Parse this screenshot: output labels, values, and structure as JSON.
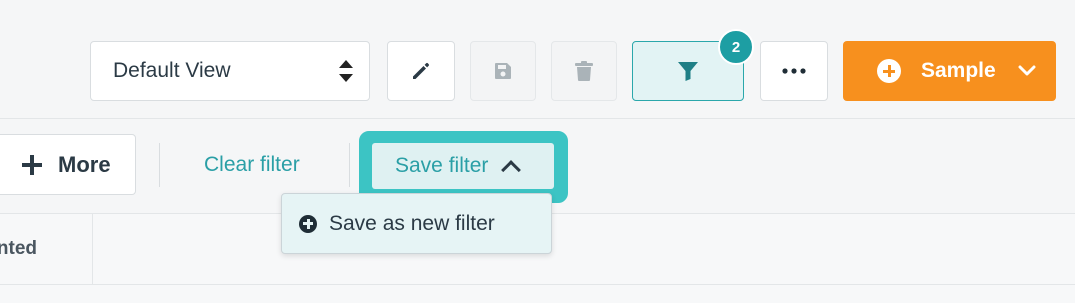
{
  "toolbar": {
    "view_select": {
      "value": "Default View"
    },
    "edit_icon": "pencil-icon",
    "save_view_icon": "floppy-disk-icon",
    "delete_icon": "trash-icon",
    "filter_icon": "funnel-icon",
    "filter_count": "2",
    "more_icon": "ellipsis-icon",
    "sample_button": {
      "label": "Sample",
      "icon": "plus-circle-icon",
      "dropdown_icon": "chevron-down-icon"
    }
  },
  "filter_bar": {
    "add_more_label": "More",
    "clear_filter_label": "Clear filter",
    "save_filter_label": "Save filter"
  },
  "save_filter_menu": {
    "items": [
      {
        "label": "Save as new filter",
        "icon": "plus-circle-icon"
      }
    ]
  },
  "table": {
    "column_header_partial": "nted"
  },
  "colors": {
    "accent": "#2a9fa6",
    "highlight": "#3cc4c4",
    "sample_button": "#f7901e",
    "badge": "#1d9ea3"
  }
}
